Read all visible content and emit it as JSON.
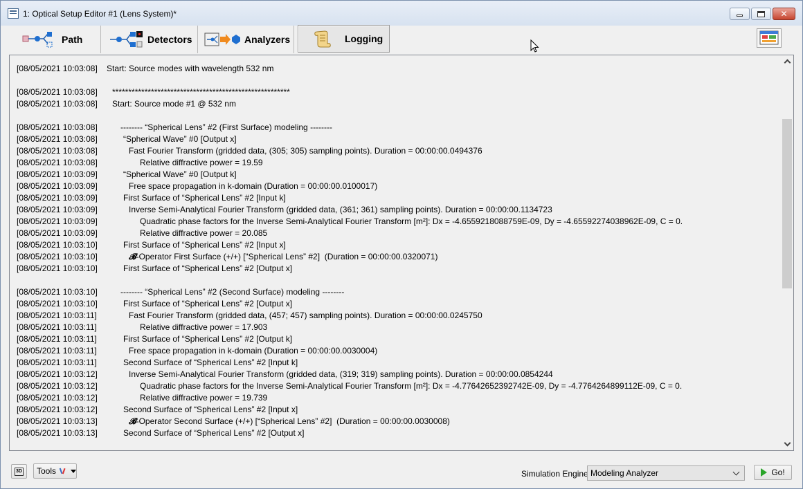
{
  "window": {
    "title": "1: Optical Setup Editor #1 (Lens System)*"
  },
  "tabs": [
    {
      "label": "Path",
      "icon": "path-icon"
    },
    {
      "label": "Detectors",
      "icon": "detectors-icon"
    },
    {
      "label": "Analyzers",
      "icon": "analyzers-icon"
    },
    {
      "label": "Logging",
      "icon": "scroll-icon",
      "active": true
    }
  ],
  "log": {
    "lines": [
      {
        "ts": "[08/05/2021 10:03:08]",
        "indent": 0,
        "text": "Start: Source modes with wavelength 532 nm"
      },
      {
        "ts": "",
        "indent": 0,
        "text": ""
      },
      {
        "ts": "[08/05/2021 10:03:08]",
        "indent": 1,
        "text": "*******************************************************"
      },
      {
        "ts": "[08/05/2021 10:03:08]",
        "indent": 1,
        "text": "Start: Source mode #1 @ 532 nm"
      },
      {
        "ts": "",
        "indent": 0,
        "text": ""
      },
      {
        "ts": "[08/05/2021 10:03:08]",
        "indent": 2,
        "text": "-------- “Spherical Lens” #2 (First Surface) modeling --------"
      },
      {
        "ts": "[08/05/2021 10:03:08]",
        "indent": 3,
        "text": "“Spherical Wave” #0 [Output x]"
      },
      {
        "ts": "[08/05/2021 10:03:08]",
        "indent": 4,
        "text": "Fast Fourier Transform (gridded data, (305; 305) sampling points). Duration = 00:00:00.0494376"
      },
      {
        "ts": "[08/05/2021 10:03:08]",
        "indent": 5,
        "text": "Relative diffractive power = 19.59"
      },
      {
        "ts": "[08/05/2021 10:03:09]",
        "indent": 3,
        "text": "“Spherical Wave” #0 [Output k]"
      },
      {
        "ts": "[08/05/2021 10:03:09]",
        "indent": 4,
        "text": "Free space propagation in k-domain (Duration = 00:00:00.0100017)"
      },
      {
        "ts": "[08/05/2021 10:03:09]",
        "indent": 3,
        "text": "First Surface of “Spherical Lens” #2 [Input k]"
      },
      {
        "ts": "[08/05/2021 10:03:09]",
        "indent": 4,
        "text": "Inverse Semi-Analytical Fourier Transform (gridded data, (361; 361) sampling points). Duration = 00:00:00.1134723"
      },
      {
        "ts": "[08/05/2021 10:03:09]",
        "indent": 5,
        "text": "Quadratic phase factors for the Inverse Semi-Analytical Fourier Transform [m²]: Dx = -4.6559218088759E-09, Dy = -4.65592274038962E-09, C = 0."
      },
      {
        "ts": "[08/05/2021 10:03:09]",
        "indent": 5,
        "text": "Relative diffractive power = 20.085"
      },
      {
        "ts": "[08/05/2021 10:03:10]",
        "indent": 3,
        "text": "First Surface of “Spherical Lens” #2 [Input x]"
      },
      {
        "ts": "[08/05/2021 10:03:10]",
        "indent": 4,
        "bop": "𝓑",
        "text": "-Operator First Surface (+/+) [“Spherical Lens” #2]  (Duration = 00:00:00.0320071)"
      },
      {
        "ts": "[08/05/2021 10:03:10]",
        "indent": 3,
        "text": "First Surface of “Spherical Lens” #2 [Output x]"
      },
      {
        "ts": "",
        "indent": 0,
        "text": ""
      },
      {
        "ts": "[08/05/2021 10:03:10]",
        "indent": 2,
        "text": "-------- “Spherical Lens” #2 (Second Surface) modeling --------"
      },
      {
        "ts": "[08/05/2021 10:03:10]",
        "indent": 3,
        "text": "First Surface of “Spherical Lens” #2 [Output x]"
      },
      {
        "ts": "[08/05/2021 10:03:11]",
        "indent": 4,
        "text": "Fast Fourier Transform (gridded data, (457; 457) sampling points). Duration = 00:00:00.0245750"
      },
      {
        "ts": "[08/05/2021 10:03:11]",
        "indent": 5,
        "text": "Relative diffractive power = 17.903"
      },
      {
        "ts": "[08/05/2021 10:03:11]",
        "indent": 3,
        "text": "First Surface of “Spherical Lens” #2 [Output k]"
      },
      {
        "ts": "[08/05/2021 10:03:11]",
        "indent": 4,
        "text": "Free space propagation in k-domain (Duration = 00:00:00.0030004)"
      },
      {
        "ts": "[08/05/2021 10:03:11]",
        "indent": 3,
        "text": "Second Surface of “Spherical Lens” #2 [Input k]"
      },
      {
        "ts": "[08/05/2021 10:03:12]",
        "indent": 4,
        "text": "Inverse Semi-Analytical Fourier Transform (gridded data, (319; 319) sampling points). Duration = 00:00:00.0854244"
      },
      {
        "ts": "[08/05/2021 10:03:12]",
        "indent": 5,
        "text": "Quadratic phase factors for the Inverse Semi-Analytical Fourier Transform [m²]: Dx = -4.77642652392742E-09, Dy = -4.7764264899112E-09, C = 0."
      },
      {
        "ts": "[08/05/2021 10:03:12]",
        "indent": 5,
        "text": "Relative diffractive power = 19.739"
      },
      {
        "ts": "[08/05/2021 10:03:12]",
        "indent": 3,
        "text": "Second Surface of “Spherical Lens” #2 [Input x]"
      },
      {
        "ts": "[08/05/2021 10:03:13]",
        "indent": 4,
        "bop": "𝓑",
        "text": "-Operator Second Surface (+/+) [“Spherical Lens” #2]  (Duration = 00:00:00.0030008)"
      },
      {
        "ts": "[08/05/2021 10:03:13]",
        "indent": 3,
        "text": "Second Surface of “Spherical Lens” #2 [Output x]"
      }
    ]
  },
  "bottom": {
    "tools_label": "Tools",
    "engine_label": "Simulation Engine",
    "engine_value": "Modeling Analyzer",
    "go_label": "Go!"
  },
  "colors": {
    "titlebar": "#dbe5f1",
    "close_button": "#c7452f",
    "go_icon": "#2aa52a"
  }
}
